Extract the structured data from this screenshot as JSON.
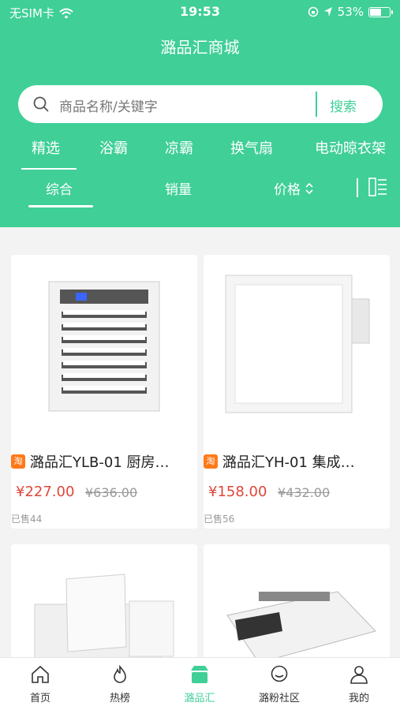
{
  "status": {
    "carrier": "无SIM卡",
    "time": "19:53",
    "battery": "53%",
    "battery_level": 0.53
  },
  "page_title": "潞品汇商城",
  "search": {
    "placeholder": "商品名称/关键字",
    "button": "搜索"
  },
  "categories": [
    "精选",
    "浴霸",
    "凉霸",
    "换气扇",
    "电动晾衣架"
  ],
  "sort": {
    "items": [
      "综合",
      "销量",
      "价格"
    ]
  },
  "products": [
    {
      "name": "潞品汇YLB-01 厨房…",
      "price": "¥227.00",
      "original_price": "¥636.00",
      "sold": "已售44"
    },
    {
      "name": "潞品汇YH-01 集成…",
      "price": "¥158.00",
      "original_price": "¥432.00",
      "sold": "已售56"
    },
    {
      "name": "",
      "price": "",
      "original_price": "",
      "sold": ""
    },
    {
      "name": "",
      "price": "",
      "original_price": "",
      "sold": ""
    }
  ],
  "tabbar": [
    "首页",
    "热榜",
    "潞品汇",
    "潞粉社区",
    "我的"
  ],
  "colors": {
    "brand": "#3fcf97",
    "price": "#e0463a",
    "badge": "#ff7a1a"
  },
  "icons": [
    "wifi-icon",
    "lock-rotation-icon",
    "location-arrow-icon",
    "battery-icon",
    "search-icon",
    "chevron-updown-icon",
    "list-layout-icon",
    "home-icon",
    "fire-icon",
    "store-icon",
    "chat-icon",
    "user-icon",
    "taobao-badge-icon"
  ]
}
